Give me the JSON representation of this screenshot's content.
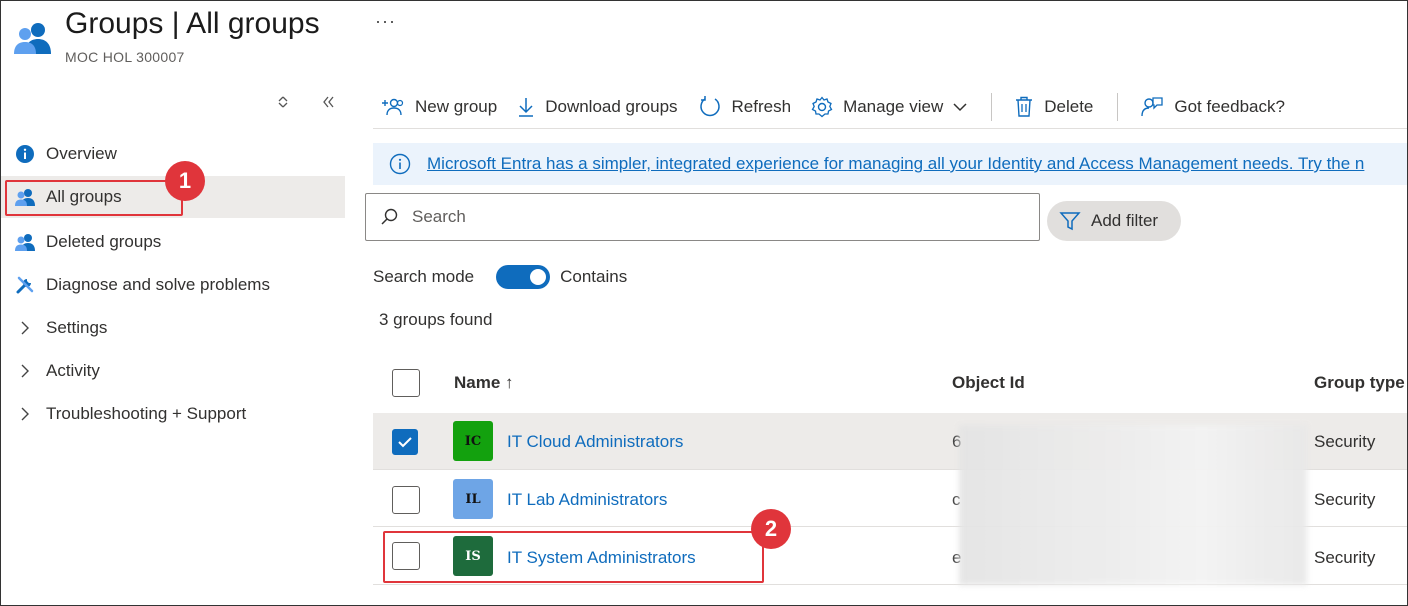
{
  "header": {
    "title": "Groups | All groups",
    "subtitle": "MOC HOL 300007",
    "more": "···",
    "icon": "groups-icon"
  },
  "sidebar": {
    "items": [
      {
        "label": "Overview",
        "icon": "info-icon"
      },
      {
        "label": "All groups",
        "icon": "groups-icon",
        "active": true
      },
      {
        "label": "Deleted groups",
        "icon": "groups-icon"
      },
      {
        "label": "Diagnose and solve problems",
        "icon": "wrench-icon"
      },
      {
        "label": "Settings",
        "icon": "chevron-right-icon"
      },
      {
        "label": "Activity",
        "icon": "chevron-right-icon"
      },
      {
        "label": "Troubleshooting + Support",
        "icon": "chevron-right-icon"
      }
    ]
  },
  "toolbar": {
    "new_group": "New group",
    "download_groups": "Download groups",
    "refresh": "Refresh",
    "manage_view": "Manage view",
    "delete": "Delete",
    "feedback": "Got feedback?"
  },
  "banner": {
    "text": "Microsoft Entra has a simpler, integrated experience for managing all your Identity and Access Management needs. Try the n"
  },
  "search": {
    "placeholder": "Search",
    "add_filter": "Add filter",
    "mode_label": "Search mode",
    "mode_value": "Contains",
    "mode_on": true,
    "results_count": "3 groups found"
  },
  "table": {
    "columns": [
      "Name ↑",
      "Object Id",
      "Group type"
    ],
    "rows": [
      {
        "initials": "IC",
        "name": "IT Cloud Administrators",
        "object_id_visible": "6",
        "type": "Security",
        "selected": true,
        "avatar_color": "#13a10e"
      },
      {
        "initials": "IL",
        "name": "IT Lab Administrators",
        "object_id_visible": "c",
        "type": "Security",
        "selected": false,
        "avatar_color": "#6ea5e6"
      },
      {
        "initials": "IS",
        "name": "IT System Administrators",
        "object_id_visible": "e",
        "type": "Security",
        "selected": false,
        "avatar_color": "#1e6b3c"
      }
    ]
  },
  "annotations": {
    "badge1": "1",
    "badge2": "2",
    "color": "#e0353b"
  },
  "colors": {
    "accent": "#0f6cbd",
    "selected_row": "#edebe9",
    "banner_bg": "#ebf3fc"
  }
}
